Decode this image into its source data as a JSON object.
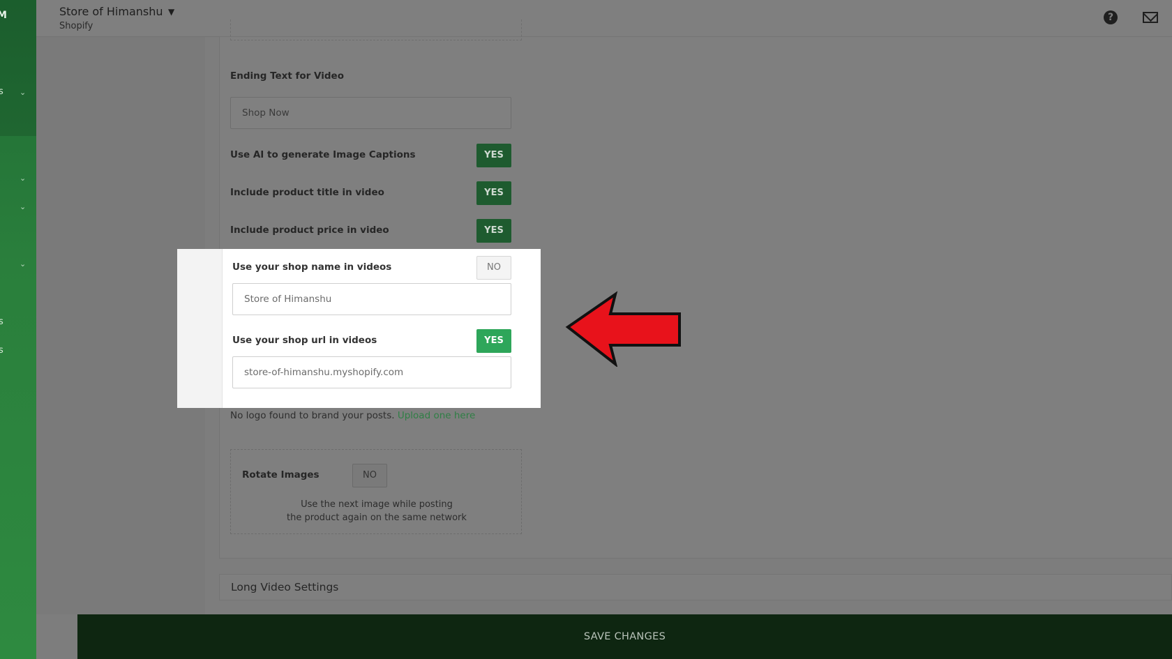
{
  "header": {
    "store_name": "Store of Himanshu",
    "platform": "Shopify",
    "icons": {
      "help": "help-circle-icon",
      "mail": "mail-icon"
    }
  },
  "sidebar": {
    "logo_fragment": "M",
    "letters": [
      "s",
      "s",
      "s"
    ],
    "chevron_icon": "chevron-down-icon"
  },
  "settings": {
    "ending_text": {
      "label": "Ending Text for Video",
      "placeholder": "Shop Now"
    },
    "ai_captions": {
      "label": "Use AI to generate Image Captions",
      "toggle": "YES"
    },
    "product_title": {
      "label": "Include product title in video",
      "toggle": "YES"
    },
    "product_price": {
      "label": "Include product price in video",
      "toggle": "YES"
    },
    "shop_name": {
      "label": "Use your shop name in videos",
      "toggle": "NO",
      "value": "Store of  Himanshu"
    },
    "shop_url": {
      "label": "Use your shop url in videos",
      "toggle": "YES",
      "value": "store-of-himanshu.myshopify.com"
    },
    "logo_note": {
      "text": "No logo found to brand your posts.",
      "link": "Upload one here"
    },
    "rotate_images": {
      "label": "Rotate Images",
      "toggle": "NO",
      "desc_line1": "Use the next image while posting",
      "desc_line2": "the product again on the same network"
    }
  },
  "sections": {
    "long_video": "Long Video Settings"
  },
  "footer": {
    "save_label": "SAVE CHANGES"
  },
  "colors": {
    "highlight_green": "#2ea65a",
    "dim_green": "#1e5b2f",
    "save_bar": "#0e2611",
    "arrow_red": "#e8121b"
  }
}
